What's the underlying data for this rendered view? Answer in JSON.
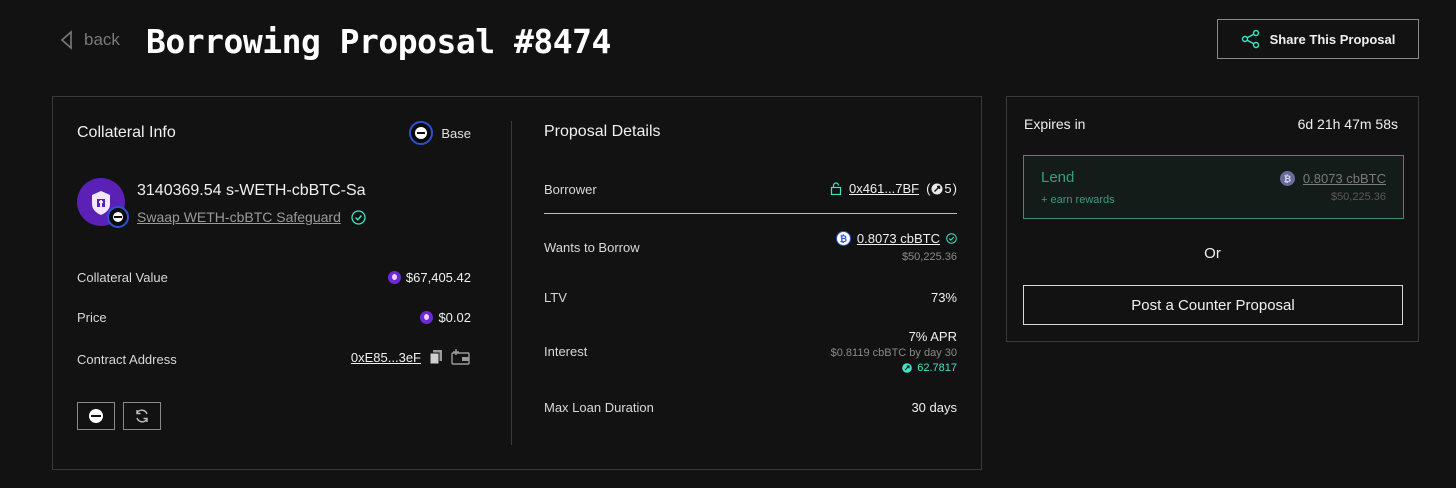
{
  "header": {
    "back_label": "back",
    "title": "Borrowing Proposal #8474",
    "share_label": "Share This Proposal"
  },
  "collateral": {
    "title": "Collateral Info",
    "chain": "Base",
    "amount": "3140369.54 s-WETH-cbBTC-Sa",
    "token_name": "Swaap WETH-cbBTC Safeguard",
    "rows": [
      {
        "label": "Collateral Value",
        "value": "$67,405.42"
      },
      {
        "label": "Price",
        "value": "$0.02"
      },
      {
        "label": "Contract Address",
        "value": "0xE85...3eF"
      }
    ]
  },
  "proposal": {
    "title": "Proposal Details",
    "borrower_label": "Borrower",
    "borrower_address": "0x461...7BF",
    "borrower_score": "5",
    "borrow_label": "Wants to Borrow",
    "borrow_amount": "0.8073 cbBTC",
    "borrow_usd": "$50,225.36",
    "ltv_label": "LTV",
    "ltv_value": "73%",
    "interest_label": "Interest",
    "interest_apr": "7% APR",
    "interest_sub": "$0.8119 cbBTC by day 30",
    "interest_points": "62.7817",
    "duration_label": "Max Loan Duration",
    "duration_value": "30 days"
  },
  "side": {
    "expires_label": "Expires in",
    "expires_value": "6d 21h 47m 58s",
    "lend_label": "Lend",
    "lend_sub": "+ earn rewards",
    "lend_amount": "0.8073 cbBTC",
    "lend_usd": "$50,225.36",
    "or_label": "Or",
    "counter_label": "Post a Counter Proposal"
  },
  "colors": {
    "background": "#121212",
    "accent_teal": "#3ee6c4",
    "lend_border": "#3b8f78",
    "token_purple": "#5b21b6",
    "base_blue": "#2b52d6"
  }
}
